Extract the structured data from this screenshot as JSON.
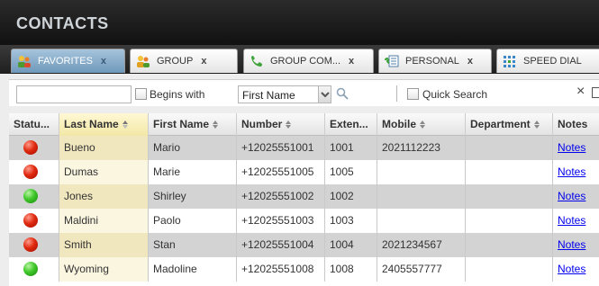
{
  "app": {
    "title": "CONTACTS"
  },
  "tabs": [
    {
      "label": "FAVORITES",
      "close": "x",
      "icon": "favorites-people-icon",
      "active": true
    },
    {
      "label": "GROUP",
      "close": "x",
      "icon": "group-people-icon",
      "active": false
    },
    {
      "label": "GROUP COM...",
      "close": "x",
      "icon": "group-common-phone-icon",
      "active": false
    },
    {
      "label": "PERSONAL",
      "close": "x",
      "icon": "personal-contacts-icon",
      "active": false
    },
    {
      "label": "SPEED DIAL",
      "close": "",
      "icon": "speed-dial-grid-icon",
      "active": false
    }
  ],
  "toolbar": {
    "search_value": "",
    "begins_with_label": "Begins with",
    "field_select_value": "First Name",
    "quick_search_label": "Quick Search",
    "clear_glyph": "×"
  },
  "table": {
    "columns": [
      "Statu...",
      "Last Name",
      "First Name",
      "Number",
      "Exten...",
      "Mobile",
      "Department",
      "Notes"
    ],
    "sorted_column": "Last Name",
    "rows": [
      {
        "status": "red",
        "last": "Bueno",
        "first": "Mario",
        "number": "+12025551001",
        "ext": "1001",
        "mobile": "2021112223",
        "department": "",
        "notes": "Notes"
      },
      {
        "status": "red",
        "last": "Dumas",
        "first": "Marie",
        "number": "+12025551005",
        "ext": "1005",
        "mobile": "",
        "department": "",
        "notes": "Notes"
      },
      {
        "status": "green",
        "last": "Jones",
        "first": "Shirley",
        "number": "+12025551002",
        "ext": "1002",
        "mobile": "",
        "department": "",
        "notes": "Notes"
      },
      {
        "status": "red",
        "last": "Maldini",
        "first": "Paolo",
        "number": "+12025551003",
        "ext": "1003",
        "mobile": "",
        "department": "",
        "notes": "Notes"
      },
      {
        "status": "red",
        "last": "Smith",
        "first": "Stan",
        "number": "+12025551004",
        "ext": "1004",
        "mobile": "2021234567",
        "department": "",
        "notes": "Notes"
      },
      {
        "status": "green",
        "last": "Wyoming",
        "first": "Madoline",
        "number": "+12025551008",
        "ext": "1008",
        "mobile": "2405557777",
        "department": "",
        "notes": "Notes"
      }
    ]
  },
  "colors": {
    "titlebar": "#1a1a1a",
    "active_tab": "#7fa4c4",
    "status_available": "#3fc72a",
    "status_busy": "#e02a10",
    "link": "#0000ee"
  }
}
